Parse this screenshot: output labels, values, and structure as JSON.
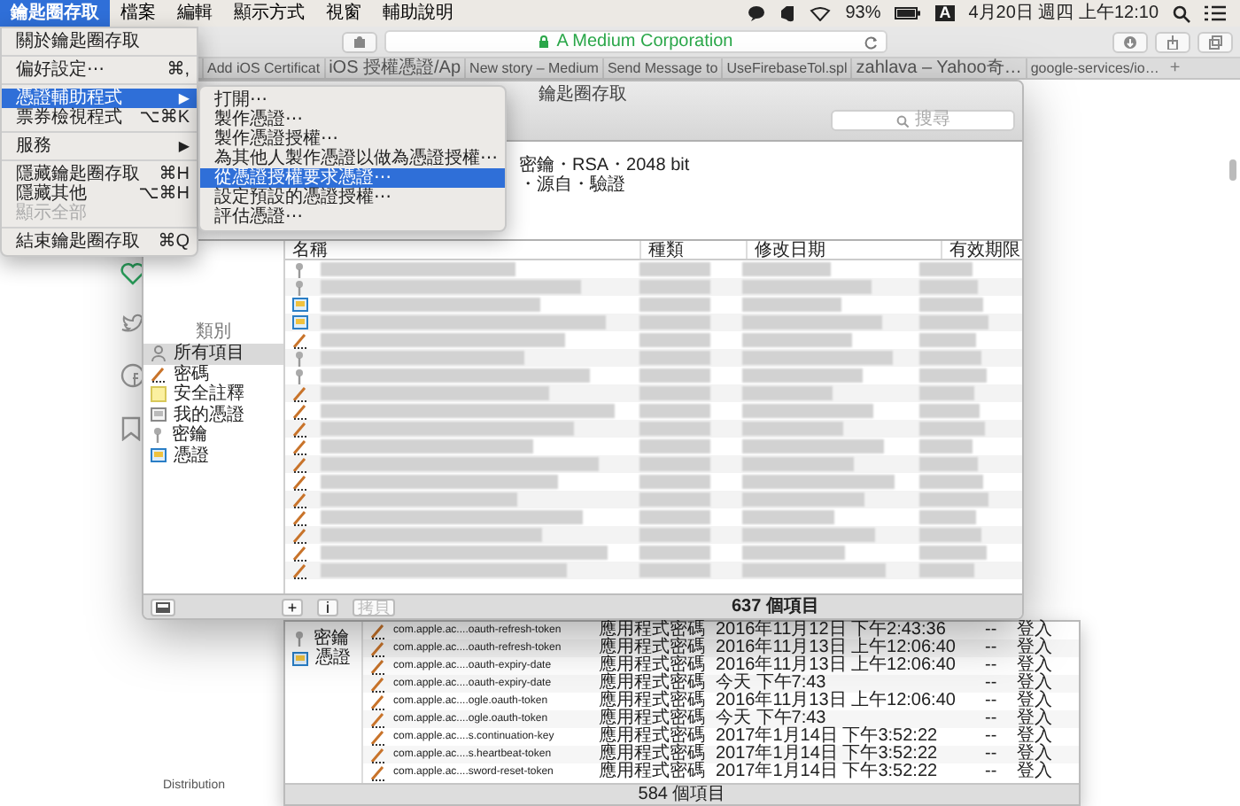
{
  "menubar": {
    "menus": [
      {
        "label": "鑰匙圈存取",
        "selected": true
      },
      {
        "label": "檔案",
        "selected": false
      },
      {
        "label": "編輯",
        "selected": false
      },
      {
        "label": "顯示方式",
        "selected": false
      },
      {
        "label": "視窗",
        "selected": false
      },
      {
        "label": "輔助說明",
        "selected": false
      }
    ],
    "battery": "93%",
    "input_source": "A",
    "clock": "4月20日 週四 上午12:10"
  },
  "browser": {
    "url": "A Medium Corporation",
    "tabs": [
      {
        "label": "Add iOS Certificat"
      },
      {
        "label": "iOS 授權憑證/Ap"
      },
      {
        "label": "New story – Medium"
      },
      {
        "label": "Send Message to"
      },
      {
        "label": "UseFirebaseTol.spl"
      },
      {
        "label": "zahlava – Yahoo奇…"
      },
      {
        "label": "google-services/io…"
      }
    ],
    "new_tab": "+"
  },
  "app_menu": {
    "items": [
      {
        "kind": "item",
        "label": "關於鑰匙圈存取",
        "selected": false,
        "disabled": false
      },
      {
        "kind": "separator"
      },
      {
        "kind": "item",
        "label": "偏好設定⋯",
        "shortcut": "⌘,",
        "selected": false,
        "disabled": false
      },
      {
        "kind": "separator"
      },
      {
        "kind": "item",
        "label": "憑證輔助程式",
        "arrow": "▶",
        "selected": true,
        "disabled": false
      },
      {
        "kind": "item",
        "label": "票券檢視程式",
        "shortcut": "⌥⌘K",
        "selected": false,
        "disabled": false
      },
      {
        "kind": "separator"
      },
      {
        "kind": "item",
        "label": "服務",
        "arrow": "▶",
        "selected": false,
        "disabled": false
      },
      {
        "kind": "separator"
      },
      {
        "kind": "item",
        "label": "隱藏鑰匙圈存取",
        "shortcut": "⌘H",
        "selected": false,
        "disabled": false
      },
      {
        "kind": "item",
        "label": "隱藏其他",
        "shortcut": "⌥⌘H",
        "selected": false,
        "disabled": false
      },
      {
        "kind": "item",
        "label": "顯示全部",
        "selected": false,
        "disabled": true
      },
      {
        "kind": "separator"
      },
      {
        "kind": "item",
        "label": "結束鑰匙圈存取",
        "shortcut": "⌘Q",
        "selected": false,
        "disabled": false
      }
    ]
  },
  "submenu": {
    "items": [
      {
        "label": "打開⋯",
        "selected": false
      },
      {
        "label": "製作憑證⋯",
        "selected": false
      },
      {
        "label": "製作憑證授權⋯",
        "selected": false
      },
      {
        "label": "為其他人製作憑證以做為憑證授權⋯",
        "selected": false
      },
      {
        "label": "從憑證授權要求憑證⋯",
        "selected": true
      },
      {
        "label": "設定預設的憑證授權⋯",
        "selected": false
      },
      {
        "label": "評估憑證⋯",
        "selected": false
      }
    ]
  },
  "keychain": {
    "title": "鑰匙圈存取",
    "search_placeholder": "搜尋",
    "info_lines": [
      "密鑰・RSA・2048 bit",
      "・源自・驗證"
    ],
    "category_heading": "類別",
    "categories": [
      {
        "label": "所有項目",
        "kind": "all",
        "selected": true
      },
      {
        "label": "密碼",
        "kind": "password",
        "selected": false
      },
      {
        "label": "安全註釋",
        "kind": "note",
        "selected": false
      },
      {
        "label": "我的憑證",
        "kind": "mycert",
        "selected": false
      },
      {
        "label": "密鑰",
        "kind": "key",
        "selected": false
      },
      {
        "label": "憑證",
        "kind": "certificate",
        "selected": false
      }
    ],
    "columns": [
      "名稱",
      "種類",
      "修改日期",
      "有效期限"
    ],
    "rows": [
      {
        "kind": "key"
      },
      {
        "kind": "key"
      },
      {
        "kind": "certificate"
      },
      {
        "kind": "certificate"
      },
      {
        "kind": "password"
      },
      {
        "kind": "key"
      },
      {
        "kind": "key"
      },
      {
        "kind": "password"
      },
      {
        "kind": "password"
      },
      {
        "kind": "password"
      },
      {
        "kind": "password"
      },
      {
        "kind": "password"
      },
      {
        "kind": "password"
      },
      {
        "kind": "password"
      },
      {
        "kind": "password"
      },
      {
        "kind": "password"
      },
      {
        "kind": "password"
      },
      {
        "kind": "password"
      }
    ],
    "buttons": [
      {
        "label": "+",
        "disabled": false
      },
      {
        "label": "i",
        "disabled": false
      },
      {
        "label": "拷貝",
        "disabled": true
      }
    ],
    "count": "637 個項目"
  },
  "background_screenshot": {
    "categories": [
      {
        "label": "密鑰",
        "kind": "key"
      },
      {
        "label": "憑證",
        "kind": "certificate"
      }
    ],
    "rows": [
      {
        "kind": "password",
        "name": "com.apple.ac....oauth-refresh-token",
        "type": "應用程式密碼",
        "modified": "2016年11月12日 下午2:43:36",
        "expires": "--",
        "keychain": "登入"
      },
      {
        "kind": "password",
        "name": "com.apple.ac....oauth-refresh-token",
        "type": "應用程式密碼",
        "modified": "2016年11月13日 上午12:06:40",
        "expires": "--",
        "keychain": "登入"
      },
      {
        "kind": "password",
        "name": "com.apple.ac....oauth-expiry-date",
        "type": "應用程式密碼",
        "modified": "2016年11月13日 上午12:06:40",
        "expires": "--",
        "keychain": "登入"
      },
      {
        "kind": "password",
        "name": "com.apple.ac....oauth-expiry-date",
        "type": "應用程式密碼",
        "modified": "今天 下午7:43",
        "expires": "--",
        "keychain": "登入"
      },
      {
        "kind": "password",
        "name": "com.apple.ac....ogle.oauth-token",
        "type": "應用程式密碼",
        "modified": "2016年11月13日 上午12:06:40",
        "expires": "--",
        "keychain": "登入"
      },
      {
        "kind": "password",
        "name": "com.apple.ac....ogle.oauth-token",
        "type": "應用程式密碼",
        "modified": "今天 下午7:43",
        "expires": "--",
        "keychain": "登入"
      },
      {
        "kind": "password",
        "name": "com.apple.ac....s.continuation-key",
        "type": "應用程式密碼",
        "modified": "2017年1月14日 下午3:52:22",
        "expires": "--",
        "keychain": "登入"
      },
      {
        "kind": "password",
        "name": "com.apple.ac....s.heartbeat-token",
        "type": "應用程式密碼",
        "modified": "2017年1月14日 下午3:52:22",
        "expires": "--",
        "keychain": "登入"
      },
      {
        "kind": "password",
        "name": "com.apple.ac....sword-reset-token",
        "type": "應用程式密碼",
        "modified": "2017年1月14日 下午3:52:22",
        "expires": "--",
        "keychain": "登入"
      }
    ],
    "count": "584 個項目",
    "footer_label": "Distribution"
  }
}
